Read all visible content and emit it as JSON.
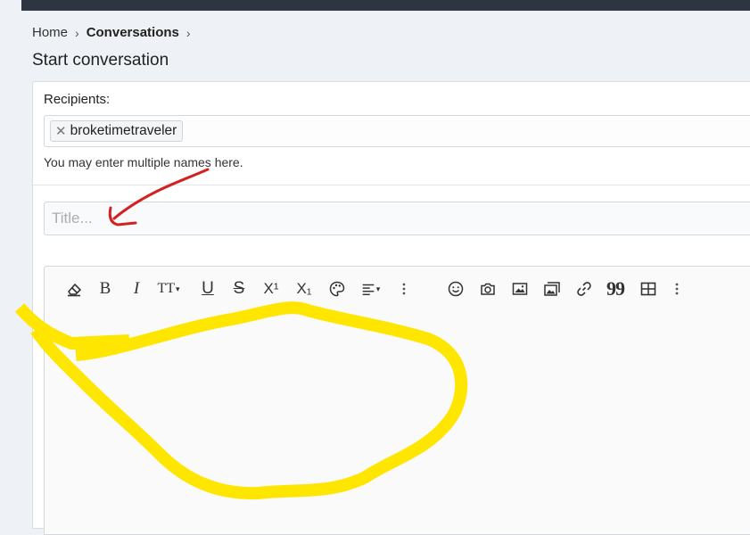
{
  "breadcrumb": {
    "home": "Home",
    "separator": "›",
    "current": "Conversations"
  },
  "page": {
    "title": "Start conversation"
  },
  "recipients": {
    "label": "Recipients:",
    "tokens": [
      {
        "name": "broketimetraveler",
        "remove": "✕"
      }
    ],
    "hint": "You may enter multiple names here."
  },
  "title_field": {
    "placeholder": "Title...",
    "value": ""
  },
  "toolbar": {
    "icons": [
      "eraser-icon",
      "bold-icon",
      "italic-icon",
      "text-size-icon",
      "underline-icon",
      "strikethrough-icon",
      "superscript-icon",
      "subscript-icon",
      "palette-icon",
      "align-icon",
      "more-options-icon",
      "smilie-icon",
      "camera-icon",
      "image-icon",
      "media-gallery-icon",
      "link-icon",
      "quote-icon",
      "table-icon",
      "more-options-icon"
    ],
    "bold": "B",
    "italic": "I",
    "text_size": "TT",
    "underline": "U",
    "strike": "S",
    "superscript": "X¹",
    "subscript": "X₁",
    "quote": "99"
  },
  "colors": {
    "annotation_red": "#d42020",
    "annotation_yellow": "#ffe600",
    "topbar": "#2e3440"
  }
}
